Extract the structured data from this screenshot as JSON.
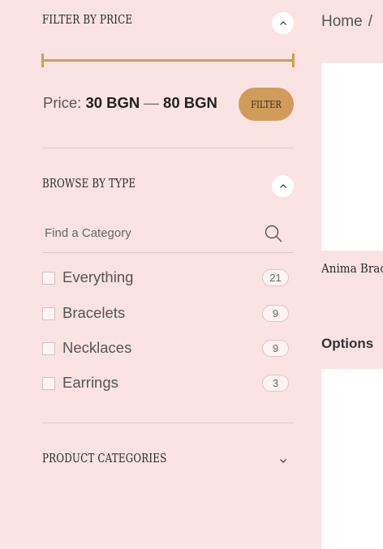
{
  "filter_price": {
    "title": "FILTER BY PRICE",
    "price_label": "Price:",
    "min_price": "30 BGN",
    "separator": "—",
    "max_price": "80 BGN",
    "filter_button": "FILTER",
    "range_fraction": [
      0.0,
      1.0
    ]
  },
  "browse_by_type": {
    "title": "BROWSE BY TYPE",
    "search_placeholder": "Find a Category",
    "items": [
      {
        "label": "Everything",
        "count": "21"
      },
      {
        "label": "Bracelets",
        "count": "9"
      },
      {
        "label": "Necklaces",
        "count": "9"
      },
      {
        "label": "Earrings",
        "count": "3"
      }
    ]
  },
  "product_categories": {
    "title": "PRODUCT CATEGORIES"
  },
  "main": {
    "breadcrumb_home": "Home",
    "breadcrumb_sep": "/",
    "product_title": "Anima Brac",
    "options_label": "Options"
  },
  "colors": {
    "sidebar_bg": "#fbe3e3",
    "accent": "#d19c5a",
    "text_dark": "#2a2a2a"
  }
}
